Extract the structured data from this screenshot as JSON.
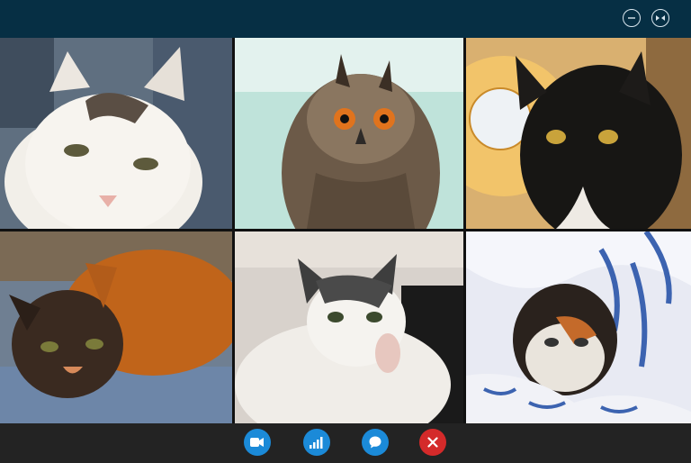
{
  "window": {
    "controls": [
      {
        "name": "minimize-icon"
      },
      {
        "name": "fullscreen-icon"
      }
    ]
  },
  "participants": [
    {
      "subject": "white-cat",
      "background": "#6b7a88"
    },
    {
      "subject": "eagle-owl",
      "background": "#bfe3da"
    },
    {
      "subject": "black-cat",
      "background": "#e9c27a"
    },
    {
      "subject": "tortoiseshell-cat",
      "background": "#6f7f92"
    },
    {
      "subject": "white-grey-cat",
      "background": "#d8d2cc"
    },
    {
      "subject": "calico-cat-in-blanket",
      "background": "#e8eaf3"
    }
  ],
  "call_controls": [
    {
      "name": "video-icon",
      "color": "#1b8ad8"
    },
    {
      "name": "call-quality-icon",
      "color": "#1b8ad8"
    },
    {
      "name": "chat-icon",
      "color": "#1b8ad8"
    },
    {
      "name": "end-call-icon",
      "color": "#d42a2a"
    }
  ]
}
